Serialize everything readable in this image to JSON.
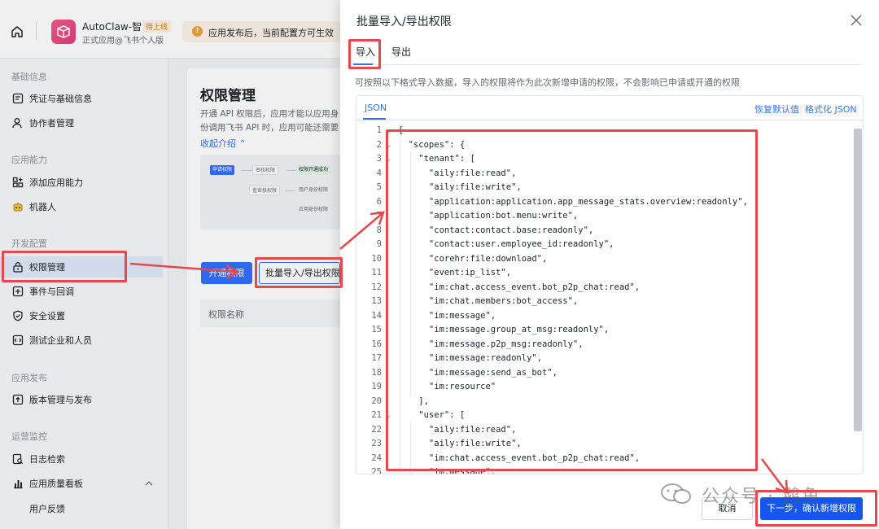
{
  "topbar": {
    "app_name": "AutoClaw-智谱",
    "app_tag": "待上线",
    "app_sub": "正式应用@飞书个人版",
    "notice_text": "应用发布后，当前配置方可生效"
  },
  "sidebar": {
    "groups": [
      "基础信息",
      "应用能力",
      "开发配置",
      "应用发布",
      "运营监控"
    ],
    "items": [
      {
        "label": "凭证与基础信息",
        "icon": "document-icon"
      },
      {
        "label": "协作者管理",
        "icon": "user-icon"
      },
      {
        "label": "添加应用能力",
        "icon": "grid-plus-icon"
      },
      {
        "label": "机器人",
        "icon": "robot-icon"
      },
      {
        "label": "权限管理",
        "icon": "lock-icon"
      },
      {
        "label": "事件与回调",
        "icon": "event-icon"
      },
      {
        "label": "安全设置",
        "icon": "shield-icon"
      },
      {
        "label": "测试企业和人员",
        "icon": "code-icon"
      },
      {
        "label": "版本管理与发布",
        "icon": "upload-icon"
      },
      {
        "label": "日志检索",
        "icon": "search-doc-icon"
      },
      {
        "label": "应用质量看板",
        "icon": "chart-icon"
      }
    ],
    "sub_items": [
      "用户反馈"
    ]
  },
  "main": {
    "title": "权限管理",
    "desc": "开通 API 权限后，应用才能以应用身份调用飞书 API 时，应用可能还需要申请",
    "collapse": "收起介绍",
    "diagram": {
      "apply": "申请权限",
      "review": "审核权限",
      "approved": "权限开通成功",
      "query": "查审核权限",
      "user_scope": "用户身份权限",
      "app_scope": "应用身份权限"
    },
    "open_btn": "开通权限",
    "batch_btn": "批量导入/导出权限",
    "table_col": "权限名称"
  },
  "drawer": {
    "title": "批量导入/导出权限",
    "tabs": [
      "导入",
      "导出"
    ],
    "hint": "可按照以下格式导入数据，导入的权限将作为此次新增申请的权限，不会影响已申请或开通的权限",
    "editor_tab": "JSON",
    "restore": "恢复默认值",
    "format": "格式化 JSON",
    "cancel": "取消",
    "next": "下一步，确认新增权限",
    "code_lines": [
      {
        "n": "1",
        "fold": true,
        "t": "{"
      },
      {
        "n": "2",
        "fold": true,
        "t": "  \"scopes\": {"
      },
      {
        "n": "3",
        "fold": true,
        "t": "    \"tenant\": ["
      },
      {
        "n": "4",
        "fold": false,
        "t": "      \"aily:file:read\","
      },
      {
        "n": "5",
        "fold": false,
        "t": "      \"aily:file:write\","
      },
      {
        "n": "6",
        "fold": false,
        "t": "      \"application:application.app_message_stats.overview:readonly\","
      },
      {
        "n": "7",
        "fold": false,
        "t": "      \"application:bot.menu:write\","
      },
      {
        "n": "8",
        "fold": false,
        "t": "      \"contact:contact.base:readonly\","
      },
      {
        "n": "9",
        "fold": false,
        "t": "      \"contact:user.employee_id:readonly\","
      },
      {
        "n": "10",
        "fold": false,
        "t": "      \"corehr:file:download\","
      },
      {
        "n": "11",
        "fold": false,
        "t": "      \"event:ip_list\","
      },
      {
        "n": "12",
        "fold": false,
        "t": "      \"im:chat.access_event.bot_p2p_chat:read\","
      },
      {
        "n": "13",
        "fold": false,
        "t": "      \"im:chat.members:bot_access\","
      },
      {
        "n": "14",
        "fold": false,
        "t": "      \"im:message\","
      },
      {
        "n": "15",
        "fold": false,
        "t": "      \"im:message.group_at_msg:readonly\","
      },
      {
        "n": "16",
        "fold": false,
        "t": "      \"im:message.p2p_msg:readonly\","
      },
      {
        "n": "17",
        "fold": false,
        "t": "      \"im:message:readonly\","
      },
      {
        "n": "18",
        "fold": false,
        "t": "      \"im:message:send_as_bot\","
      },
      {
        "n": "19",
        "fold": false,
        "t": "      \"im:resource\""
      },
      {
        "n": "20",
        "fold": false,
        "t": "    ],"
      },
      {
        "n": "21",
        "fold": true,
        "t": "    \"user\": ["
      },
      {
        "n": "22",
        "fold": false,
        "t": "      \"aily:file:read\","
      },
      {
        "n": "23",
        "fold": false,
        "t": "      \"aily:file:write\","
      },
      {
        "n": "24",
        "fold": false,
        "t": "      \"im:chat.access_event.bot_p2p_chat:read\","
      },
      {
        "n": "25",
        "fold": false,
        "t": "      \"im:message\","
      }
    ]
  },
  "watermark": "公众号 · 鹅鱼",
  "colors": {
    "accent": "#3370ff",
    "annotation": "#e5484d",
    "primary_button": "#1456f0"
  }
}
